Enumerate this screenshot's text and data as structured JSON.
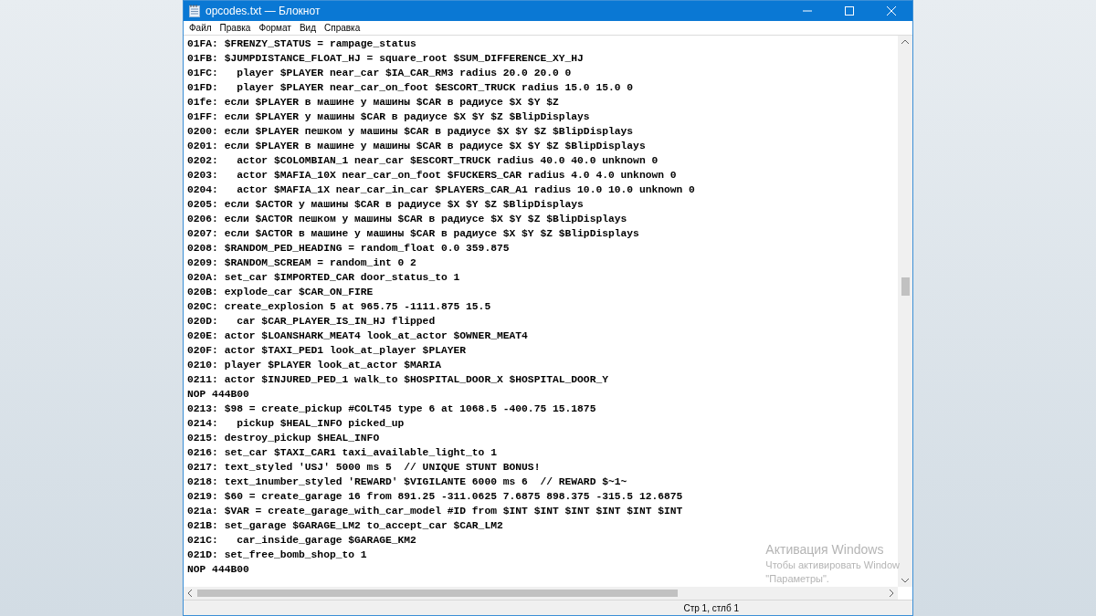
{
  "window": {
    "title": "opcodes.txt — Блокнот"
  },
  "menu": [
    {
      "label": "Файл"
    },
    {
      "label": "Правка"
    },
    {
      "label": "Формат"
    },
    {
      "label": "Вид"
    },
    {
      "label": "Справка"
    }
  ],
  "lines": [
    "01FA: $FRENZY_STATUS = rampage_status",
    "01FB: $JUMPDISTANCE_FLOAT_HJ = square_root $SUM_DIFFERENCE_XY_HJ",
    "01FC:   player $PLAYER near_car $IA_CAR_RM3 radius 20.0 20.0 0",
    "01FD:   player $PLAYER near_car_on_foot $ESCORT_TRUCK radius 15.0 15.0 0",
    "01fe: если $PLAYER в машине у машины $CAR в радиусе $X $Y $Z",
    "01FF: если $PLAYER у машины $CAR в радиусе $X $Y $Z $BlipDisplays",
    "0200: если $PLAYER пешком у машины $CAR в радиусе $X $Y $Z $BlipDisplays",
    "0201: если $PLAYER в машине у машины $CAR в радиусе $X $Y $Z $BlipDisplays",
    "0202:   actor $COLOMBIAN_1 near_car $ESCORT_TRUCK radius 40.0 40.0 unknown 0",
    "0203:   actor $MAFIA_10X near_car_on_foot $FUCKERS_CAR radius 4.0 4.0 unknown 0",
    "0204:   actor $MAFIA_1X near_car_in_car $PLAYERS_CAR_A1 radius 10.0 10.0 unknown 0",
    "0205: если $ACTOR у машины $CAR в радиусе $X $Y $Z $BlipDisplays",
    "0206: если $ACTOR пешком у машины $CAR в радиусе $X $Y $Z $BlipDisplays",
    "0207: если $ACTOR в машине у машины $CAR в радиусе $X $Y $Z $BlipDisplays",
    "0208: $RANDOM_PED_HEADING = random_float 0.0 359.875",
    "0209: $RANDOM_SCREAM = random_int 0 2",
    "020A: set_car $IMPORTED_CAR door_status_to 1",
    "020B: explode_car $CAR_ON_FIRE",
    "020C: create_explosion 5 at 965.75 -1111.875 15.5",
    "020D:   car $CAR_PLAYER_IS_IN_HJ flipped",
    "020E: actor $LOANSHARK_MEAT4 look_at_actor $OWNER_MEAT4",
    "020F: actor $TAXI_PED1 look_at_player $PLAYER",
    "0210: player $PLAYER look_at_actor $MARIA",
    "0211: actor $INJURED_PED_1 walk_to $HOSPITAL_DOOR_X $HOSPITAL_DOOR_Y",
    "NOP 444B00",
    "0213: $98 = create_pickup #COLT45 type 6 at 1068.5 -400.75 15.1875",
    "0214:   pickup $HEAL_INFO picked_up",
    "0215: destroy_pickup $HEAL_INFO",
    "0216: set_car $TAXI_CAR1 taxi_available_light_to 1",
    "0217: text_styled 'USJ' 5000 ms 5  // UNIQUE STUNT BONUS!",
    "0218: text_1number_styled 'REWARD' $VIGILANTE 6000 ms 6  // REWARD $~1~",
    "0219: $60 = create_garage 16 from 891.25 -311.0625 7.6875 898.375 -315.5 12.6875",
    "021a: $VAR = create_garage_with_car_model #ID from $INT $INT $INT $INT $INT $INT",
    "021B: set_garage $GARAGE_LM2 to_accept_car $CAR_LM2",
    "021C:   car_inside_garage $GARAGE_KM2",
    "021D: set_free_bomb_shop_to 1",
    "NOP 444B00"
  ],
  "activation": {
    "title": "Активация Windows",
    "line_1": "Чтобы активировать Window",
    "line_2": "\"Параметры\"."
  },
  "status_bar": {
    "position": "Стр 1, стлб 1"
  }
}
